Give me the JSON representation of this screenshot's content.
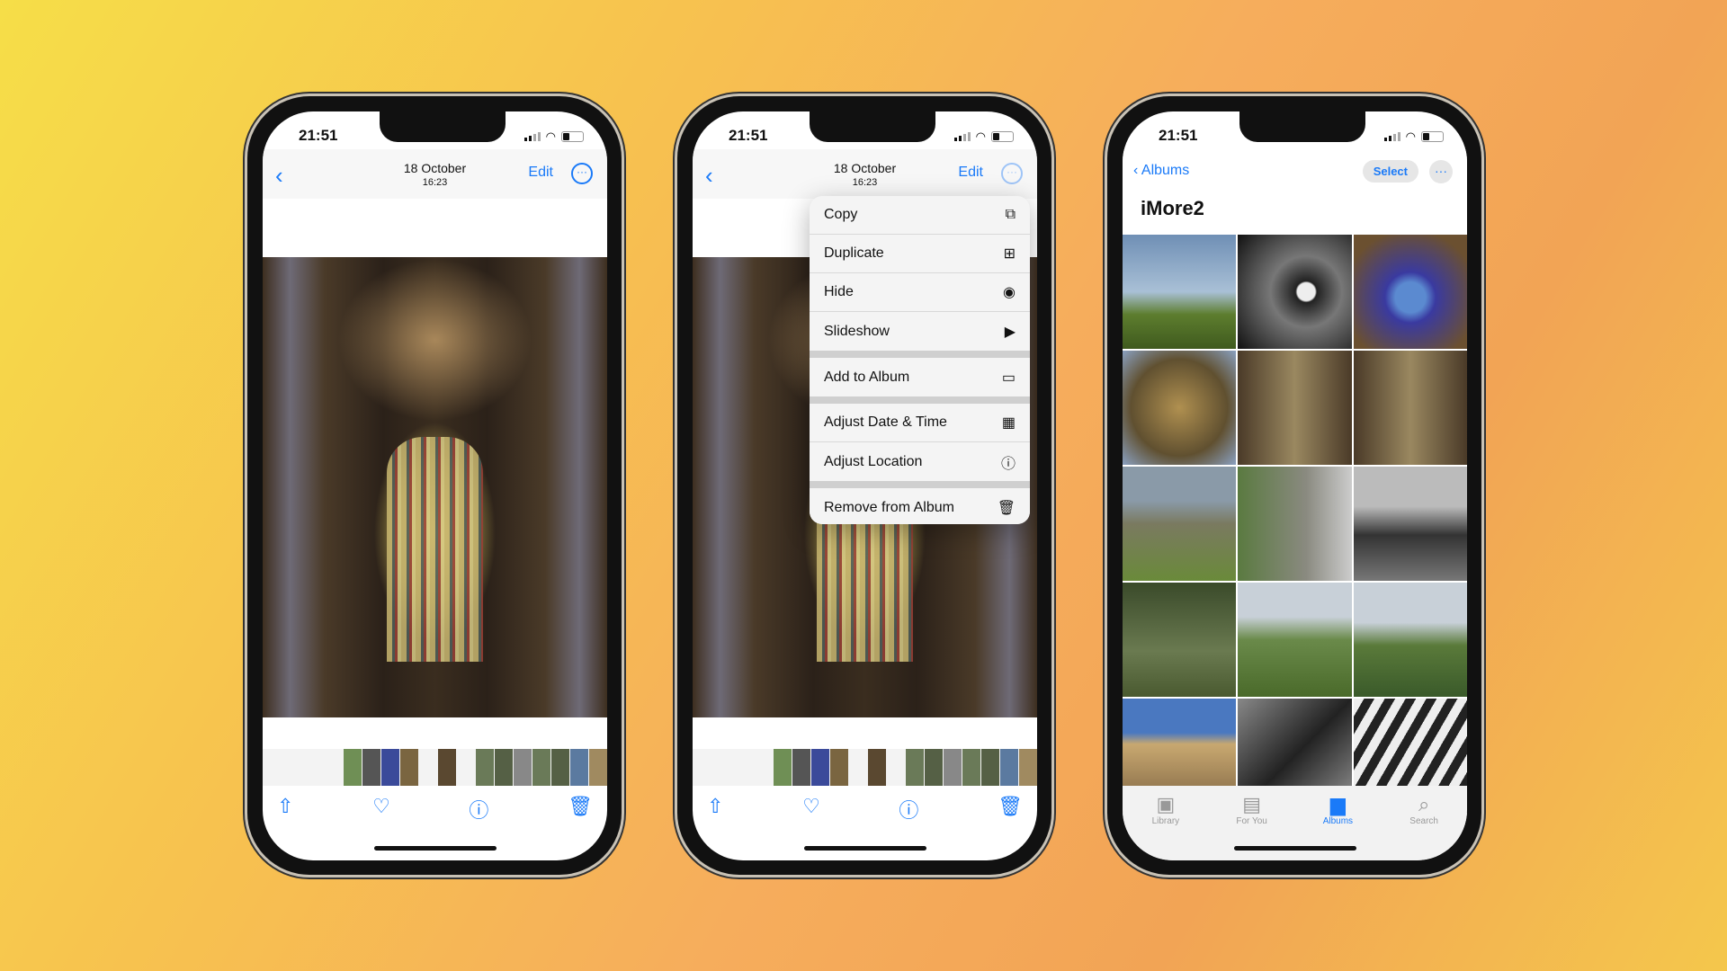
{
  "status": {
    "time": "21:51"
  },
  "viewer": {
    "date": "18 October",
    "time": "16:23",
    "edit": "Edit",
    "back_icon": "‹",
    "more_icon": "···",
    "toolbar": {
      "share_icon": "⇧",
      "favorite_icon": "♡",
      "info_icon": "ⓘ",
      "delete_icon": "🗑"
    }
  },
  "menu": {
    "items": [
      {
        "label": "Copy",
        "icon": "⧉"
      },
      {
        "label": "Duplicate",
        "icon": "⊞"
      },
      {
        "label": "Hide",
        "icon": "◉"
      },
      {
        "label": "Slideshow",
        "icon": "▶"
      },
      {
        "label": "Add to Album",
        "icon": "▭"
      },
      {
        "label": "Adjust Date & Time",
        "icon": "▦"
      },
      {
        "label": "Adjust Location",
        "icon": "ⓘ"
      },
      {
        "label": "Remove from Album",
        "icon": "🗑"
      }
    ]
  },
  "album": {
    "back": "Albums",
    "title": "iMore2",
    "select": "Select",
    "more_icon": "···"
  },
  "tabs": [
    {
      "label": "Library",
      "icon": "▣"
    },
    {
      "label": "For You",
      "icon": "▤"
    },
    {
      "label": "Albums",
      "icon": "▆"
    },
    {
      "label": "Search",
      "icon": "⌕"
    }
  ],
  "colors": {
    "accent": "#1a7af8"
  }
}
